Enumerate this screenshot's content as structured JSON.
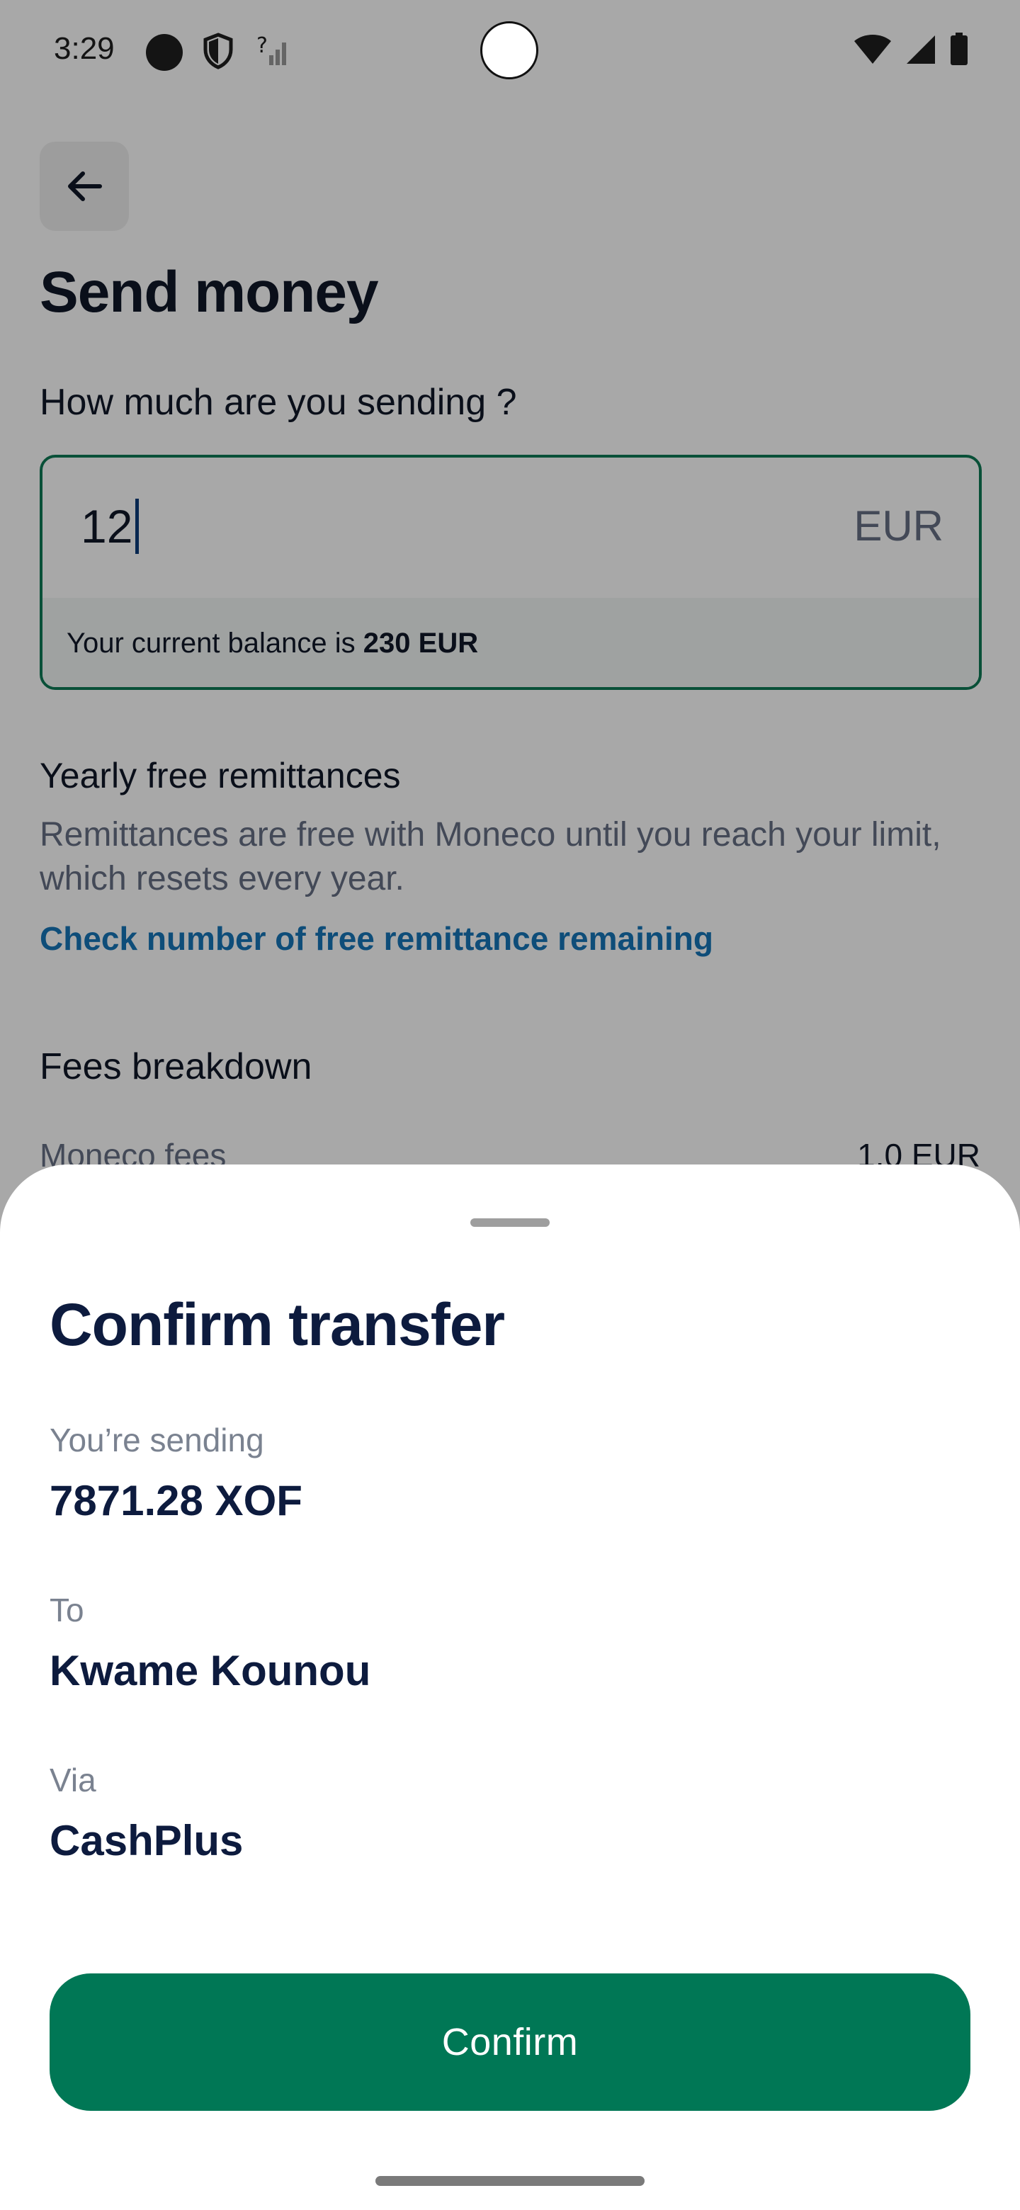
{
  "status_bar": {
    "time": "3:29",
    "icons": [
      "notification-dot-icon",
      "shield-icon",
      "signal-unknown-icon",
      "wifi-icon",
      "cell-signal-icon",
      "battery-icon"
    ]
  },
  "background_page": {
    "title": "Send money",
    "amount_label": "How much are you sending ?",
    "amount_value": "12",
    "amount_currency": "EUR",
    "balance_prefix": "Your current balance is",
    "balance_amount": "230 EUR",
    "free_title": "Yearly free remittances",
    "free_desc": "Remittances are free with Moneco until you reach your limit, which resets every year.",
    "free_link": "Check number of free remittance remaining",
    "fees_title": "Fees breakdown",
    "fees_row_label": "Moneco fees",
    "fees_row_value": "1.0 EUR"
  },
  "sheet": {
    "title": "Confirm transfer",
    "sending_label": "You’re sending",
    "sending_value": "7871.28 XOF",
    "to_label": "To",
    "to_value": "Kwame Kounou",
    "via_label": "Via",
    "via_value": "CashPlus",
    "confirm_label": "Confirm"
  },
  "colors": {
    "primary_green": "#007755",
    "input_border": "#0e7a55",
    "link_blue": "#1675b8",
    "heading_navy": "#0d1b3e"
  }
}
